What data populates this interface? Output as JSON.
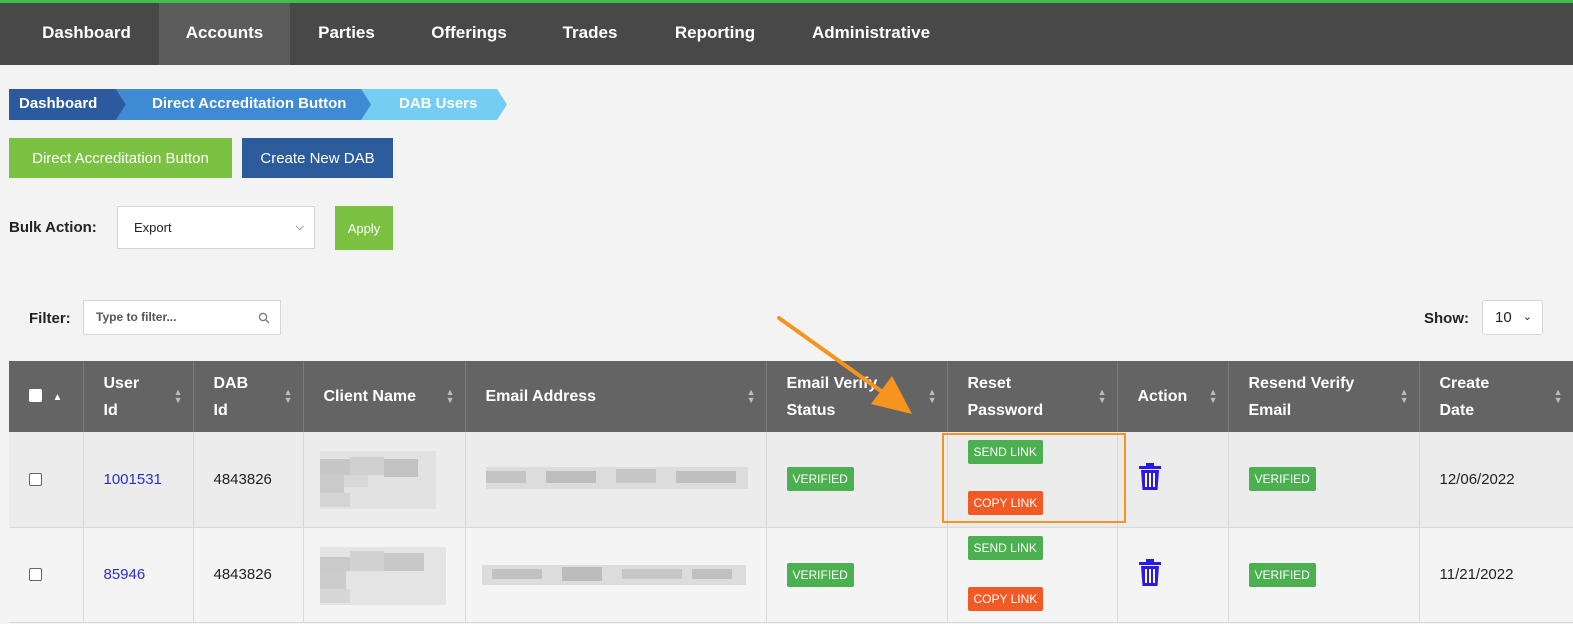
{
  "nav": {
    "items": [
      {
        "label": "Dashboard",
        "active": false
      },
      {
        "label": "Accounts",
        "active": true
      },
      {
        "label": "Parties",
        "active": false
      },
      {
        "label": "Offerings",
        "active": false
      },
      {
        "label": "Trades",
        "active": false
      },
      {
        "label": "Reporting",
        "active": false
      },
      {
        "label": "Administrative",
        "active": false
      }
    ]
  },
  "breadcrumb": [
    "Dashboard",
    "Direct Accreditation Button",
    "DAB Users"
  ],
  "buttons": {
    "direct_accreditation": "Direct Accreditation Button",
    "create_new_dab": "Create New DAB",
    "apply": "Apply"
  },
  "bulk_action": {
    "label": "Bulk Action:",
    "selected": "Export"
  },
  "filter": {
    "label": "Filter:",
    "placeholder": "Type to filter..."
  },
  "show": {
    "label": "Show:",
    "value": "10"
  },
  "table": {
    "columns": [
      "User Id",
      "DAB Id",
      "Client Name",
      "Email Address",
      "Email Verify Status",
      "Reset Password",
      "Action",
      "Resend Verify Email",
      "Create Date"
    ],
    "rows": [
      {
        "user_id": "1001531",
        "dab_id": "4843826",
        "email_status": "VERIFIED",
        "send_link": "SEND LINK",
        "copy_link": "COPY LINK",
        "resend_status": "VERIFIED",
        "create_date": "12/06/2022"
      },
      {
        "user_id": "85946",
        "dab_id": "4843826",
        "email_status": "VERIFIED",
        "send_link": "SEND LINK",
        "copy_link": "COPY LINK",
        "resend_status": "VERIFIED",
        "create_date": "11/21/2022"
      }
    ]
  },
  "colors": {
    "accent_green": "#7cc242",
    "accent_blue": "#2c5c9c",
    "badge_green": "#4caf50",
    "badge_orange": "#f15a24",
    "annotation_orange": "#f7941d",
    "trash": "#2a18e6"
  },
  "icons": [
    "search-icon",
    "chevron-down-icon",
    "sort-icon",
    "trash-icon"
  ]
}
